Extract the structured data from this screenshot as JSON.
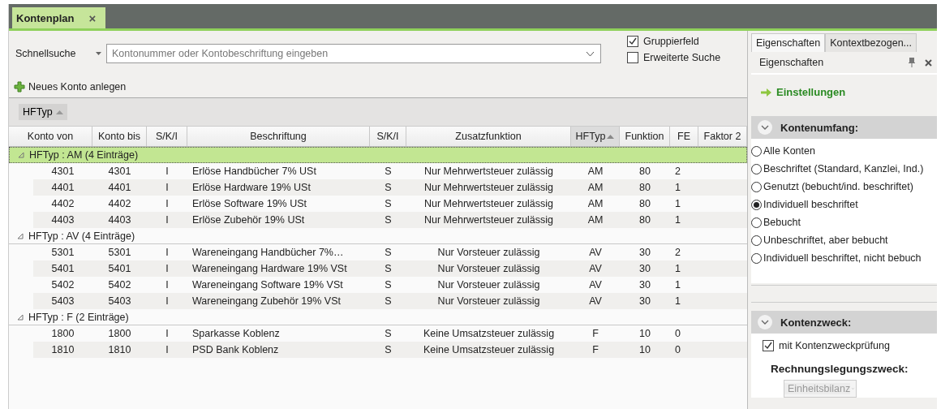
{
  "doc_tab": {
    "label": "Kontenplan",
    "close": "×"
  },
  "search": {
    "label": "Schnellsuche",
    "placeholder": "Kontonummer oder Kontobeschriftung eingeben"
  },
  "options": [
    {
      "label": "Gruppierfeld",
      "checked": true
    },
    {
      "label": "Erweiterte Suche",
      "checked": false
    }
  ],
  "new_account": "Neues Konto anlegen",
  "group_chip": "HFTyp",
  "table": {
    "columns": [
      {
        "label": "Konto von",
        "sorted": false
      },
      {
        "label": "Konto bis",
        "sorted": false
      },
      {
        "label": "S/K/I",
        "sorted": false
      },
      {
        "label": "Beschriftung",
        "sorted": false
      },
      {
        "label": "S/K/I",
        "sorted": false
      },
      {
        "label": "Zusatzfunktion",
        "sorted": false
      },
      {
        "label": "HFTyp",
        "sorted": true
      },
      {
        "label": "Funktion",
        "sorted": false
      },
      {
        "label": "FE",
        "sorted": false
      },
      {
        "label": "Faktor 2",
        "sorted": false
      }
    ],
    "groups": [
      {
        "label": "HFTyp : AM  (4 Einträge)",
        "selected": true,
        "expanded": true,
        "rows": [
          [
            "4301",
            "4301",
            "I",
            "Erlöse Handbücher 7% USt",
            "S",
            "Nur Mehrwertsteuer zulässig",
            "AM",
            "80",
            "2"
          ],
          [
            "4401",
            "4401",
            "I",
            "Erlöse Hardware 19% USt",
            "S",
            "Nur Mehrwertsteuer zulässig",
            "AM",
            "80",
            "1"
          ],
          [
            "4402",
            "4402",
            "I",
            "Erlöse Software 19% USt",
            "S",
            "Nur Mehrwertsteuer zulässig",
            "AM",
            "80",
            "1"
          ],
          [
            "4403",
            "4403",
            "I",
            "Erlöse Zubehör 19% USt",
            "S",
            "Nur Mehrwertsteuer zulässig",
            "AM",
            "80",
            "1"
          ]
        ]
      },
      {
        "label": "HFTyp : AV  (4 Einträge)",
        "selected": false,
        "expanded": true,
        "rows": [
          [
            "5301",
            "5301",
            "I",
            "Wareneingang  Handbücher  7%…",
            "S",
            "Nur Vorsteuer zulässig",
            "AV",
            "30",
            "2"
          ],
          [
            "5401",
            "5401",
            "I",
            "Wareneingang Hardware 19% VSt",
            "S",
            "Nur Vorsteuer zulässig",
            "AV",
            "30",
            "1"
          ],
          [
            "5402",
            "5402",
            "I",
            "Wareneingang Software 19% VSt",
            "S",
            "Nur Vorsteuer zulässig",
            "AV",
            "30",
            "1"
          ],
          [
            "5403",
            "5403",
            "I",
            "Wareneingang Zubehör 19% VSt",
            "S",
            "Nur Vorsteuer zulässig",
            "AV",
            "30",
            "1"
          ]
        ]
      },
      {
        "label": "HFTyp : F  (2 Einträge)",
        "selected": false,
        "expanded": true,
        "rows": [
          [
            "1800",
            "1800",
            "I",
            "Sparkasse Koblenz",
            "S",
            "Keine Umsatzsteuer zulässig",
            "F",
            "10",
            "0"
          ],
          [
            "1810",
            "1810",
            "I",
            "PSD Bank Koblenz",
            "S",
            "Keine Umsatzsteuer zulässig",
            "F",
            "10",
            "0"
          ]
        ]
      }
    ]
  },
  "side_tabs": [
    {
      "label": "Eigenschaften",
      "selected": true
    },
    {
      "label": "Kontextbezogen...",
      "selected": false
    }
  ],
  "panel": {
    "title": "Eigenschaften",
    "link": "Einstellungen",
    "scope": {
      "title": "Kontenumfang:",
      "expanded": true,
      "options": [
        {
          "label": "Alle Konten",
          "selected": false
        },
        {
          "label": "Beschriftet (Standard, Kanzlei, Ind.)",
          "selected": false
        },
        {
          "label": "Genutzt (bebucht/ind. beschriftet)",
          "selected": false
        },
        {
          "label": "Individuell beschriftet",
          "selected": true
        },
        {
          "label": "Bebucht",
          "selected": false
        },
        {
          "label": "Unbeschriftet, aber bebucht",
          "selected": false
        },
        {
          "label": "Individuell beschriftet, nicht bebuch",
          "selected": false
        }
      ]
    },
    "purpose": {
      "title": "Kontenzweck:",
      "expanded": true,
      "check": {
        "label": "mit Kontenzweckprüfung",
        "checked": true
      },
      "field_label": "Rechnungslegungszweck:",
      "field": {
        "value": "Einheitsbilanz",
        "disabled": true
      }
    }
  }
}
